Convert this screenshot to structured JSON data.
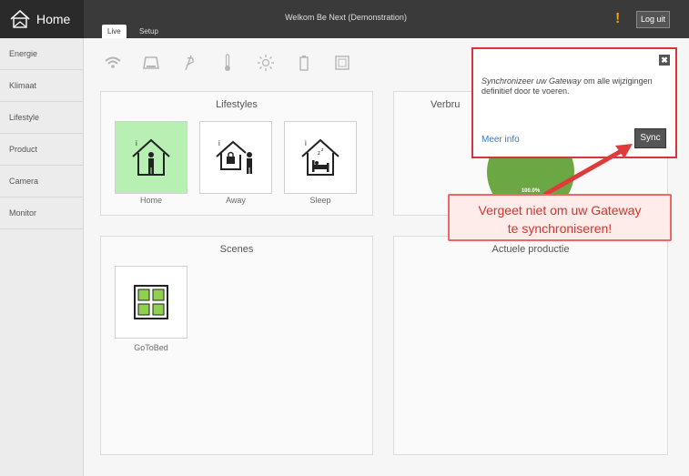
{
  "header": {
    "brand": "Home",
    "tabs": [
      {
        "label": "Live"
      },
      {
        "label": "Setup"
      }
    ],
    "title": "Welkom Be Next (Demonstration)",
    "alert": "!",
    "logout": "Log uit"
  },
  "sidebar": {
    "items": [
      {
        "label": "Energie"
      },
      {
        "label": "Klimaat"
      },
      {
        "label": "Lifestyle"
      },
      {
        "label": "Product"
      },
      {
        "label": "Camera"
      },
      {
        "label": "Monitor"
      }
    ]
  },
  "status_icons": [
    "wifi-icon",
    "gateway-icon",
    "plug-icon",
    "thermometer-icon",
    "sun-icon",
    "battery-icon",
    "display-icon"
  ],
  "panels": {
    "lifestyles": {
      "title": "Lifestyles",
      "items": [
        {
          "label": "Home",
          "active": true
        },
        {
          "label": "Away",
          "active": false
        },
        {
          "label": "Sleep",
          "active": false
        }
      ]
    },
    "verbruik": {
      "title": "Verbru",
      "gauge_percent": "100.0%"
    },
    "scenes": {
      "title": "Scenes",
      "items": [
        {
          "label": "GoToBed"
        }
      ]
    },
    "production": {
      "title": "Actuele productie"
    }
  },
  "popup": {
    "close": "✖",
    "text_italic": "Synchronizeer uw Gateway",
    "text_rest": " om alle wijzigingen definitief door te voeren.",
    "link": "Meer info",
    "sync": "Sync"
  },
  "callout": {
    "line1": "Vergeet niet om uw Gateway",
    "line2": "te synchroniseren!"
  },
  "colors": {
    "accent_red": "#d9343a",
    "active_tile": "#b7f0b2",
    "gauge_green": "#6ba843",
    "alert_orange": "#f39c12"
  }
}
